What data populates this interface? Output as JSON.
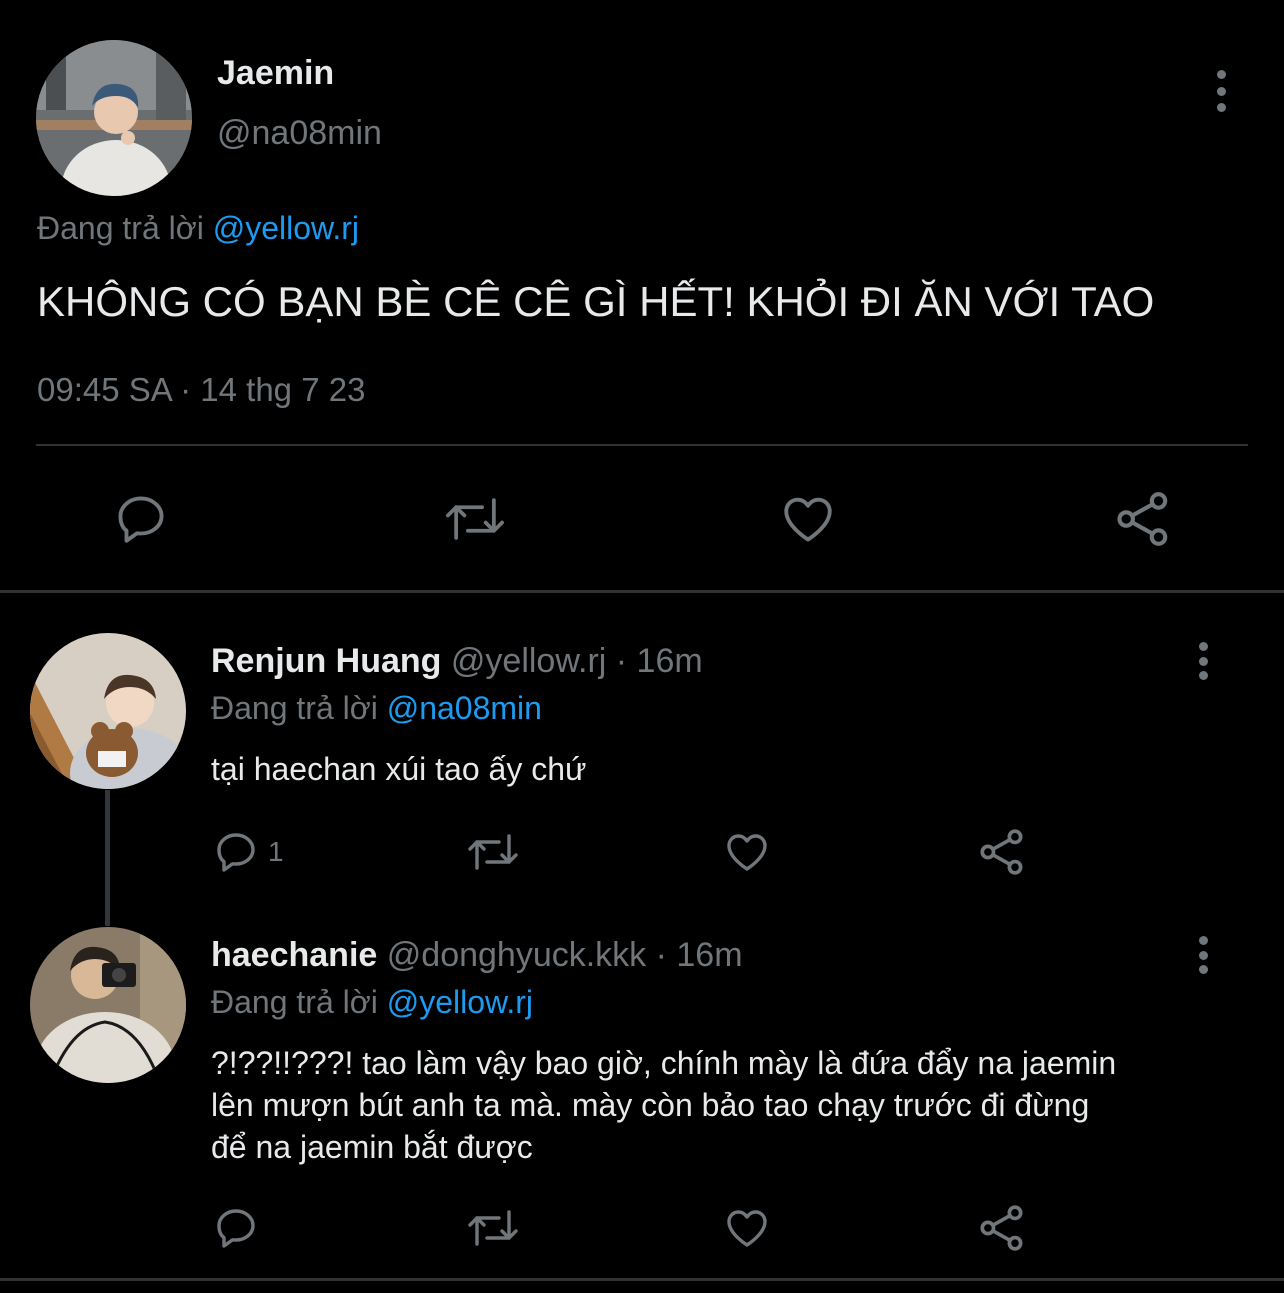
{
  "main_tweet": {
    "name": "Jaemin",
    "handle": "@na08min",
    "reply_prefix": "Đang trả lời",
    "reply_to": "@yellow.rj",
    "text": "KHÔNG CÓ BẠN BÈ CÊ CÊ GÌ HẾT! KHỎI ĐI ĂN VỚI TAO",
    "timestamp": "09:45 SA · 14 thg 7 23",
    "icons": [
      "reply-icon",
      "retweet-icon",
      "like-icon",
      "share-icon",
      "more-icon"
    ]
  },
  "replies": [
    {
      "name": "Renjun Huang",
      "meta": "@yellow.rj · 16m",
      "reply_prefix": "Đang trả lời",
      "reply_to": "@na08min",
      "text": "tại haechan xúi tao ấy chứ",
      "reply_count": "1"
    },
    {
      "name": "haechanie",
      "meta": "@donghyuck.kkk · 16m",
      "reply_prefix": "Đang trả lời",
      "reply_to": "@yellow.rj",
      "text_lines": [
        "?!??!!???! tao làm vậy bao giờ, chính mày là đứa đẩy na jaemin",
        "lên mượn bút anh ta mà. mày còn bảo tao chạy trước đi đừng",
        "để na jaemin bắt được"
      ],
      "reply_count": ""
    }
  ],
  "colors": {
    "background": "#000000",
    "text": "#e7e9ea",
    "secondary": "#71767b",
    "accent": "#1d9bf0",
    "divider": "#2f3336"
  }
}
